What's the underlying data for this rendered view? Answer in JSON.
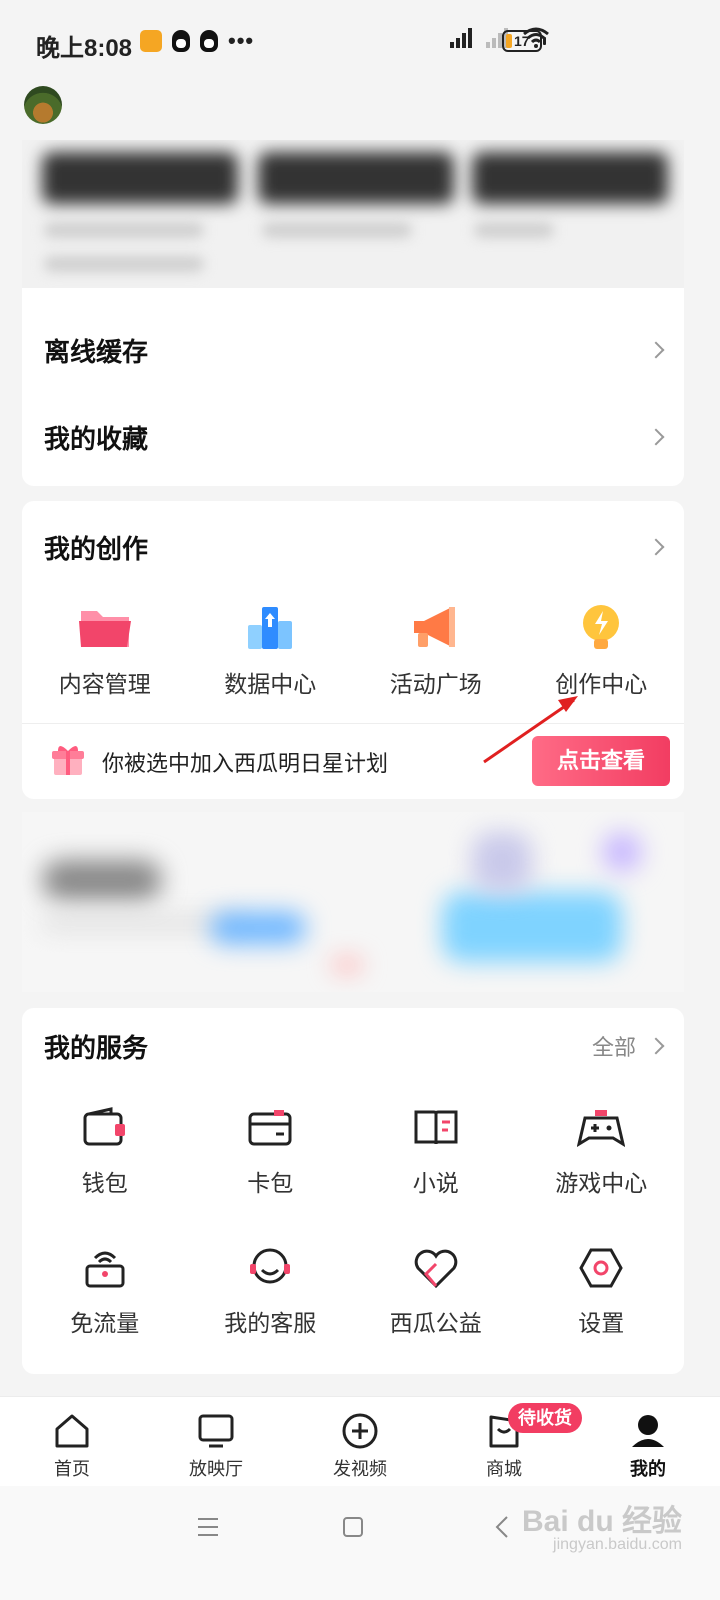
{
  "status": {
    "time": "晚上8:08",
    "battery": "17"
  },
  "menu": {
    "offline_cache": "离线缓存",
    "favorites": "我的收藏"
  },
  "creation": {
    "title": "我的创作",
    "items": [
      {
        "label": "内容管理",
        "icon": "folder-icon"
      },
      {
        "label": "数据中心",
        "icon": "data-chart-icon"
      },
      {
        "label": "活动广场",
        "icon": "megaphone-icon"
      },
      {
        "label": "创作中心",
        "icon": "lightbulb-icon"
      }
    ],
    "banner_text": "你被选中加入西瓜明日星计划",
    "banner_button": "点击查看"
  },
  "services": {
    "title": "我的服务",
    "all_label": "全部",
    "items": [
      {
        "label": "钱包",
        "icon": "wallet-icon"
      },
      {
        "label": "卡包",
        "icon": "card-icon"
      },
      {
        "label": "小说",
        "icon": "book-icon"
      },
      {
        "label": "游戏中心",
        "icon": "gamepad-icon"
      },
      {
        "label": "免流量",
        "icon": "router-icon"
      },
      {
        "label": "我的客服",
        "icon": "headset-icon"
      },
      {
        "label": "西瓜公益",
        "icon": "heart-icon"
      },
      {
        "label": "设置",
        "icon": "settings-hexagon-icon"
      }
    ]
  },
  "bottom_nav": {
    "items": [
      {
        "label": "首页",
        "icon": "home-icon"
      },
      {
        "label": "放映厅",
        "icon": "tv-icon"
      },
      {
        "label": "发视频",
        "icon": "plus-circle-icon"
      },
      {
        "label": "商城",
        "icon": "shopping-bag-icon"
      },
      {
        "label": "我的",
        "icon": "person-icon"
      }
    ],
    "mall_badge": "待收货",
    "active": "我的"
  },
  "watermark": {
    "brand": "Bai du 经验",
    "url": "jingyan.baidu.com"
  },
  "colors": {
    "accent": "#f23d62",
    "annotation": "#e02020"
  }
}
